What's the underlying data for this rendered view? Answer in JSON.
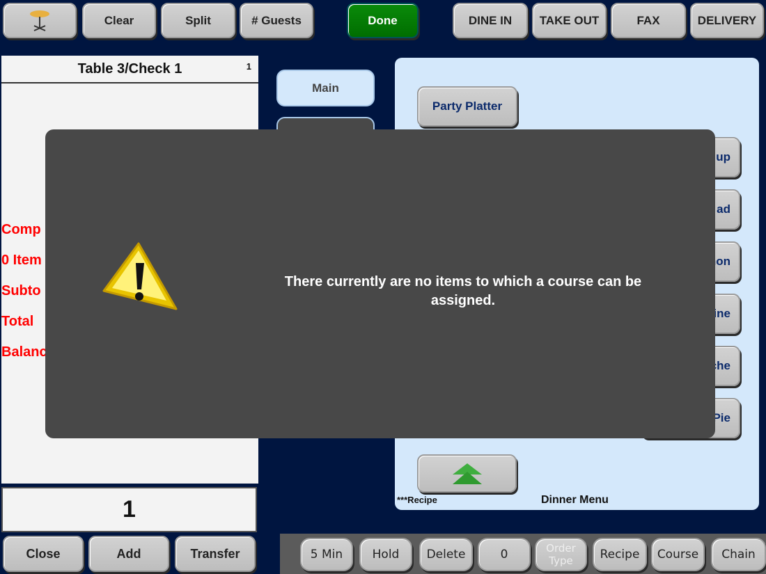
{
  "top_bar": {
    "table_icon": "table-icon",
    "clear": "Clear",
    "split": "Split",
    "guests": "# Guests",
    "done": "Done",
    "dine_in": "DINE IN",
    "take_out": "TAKE OUT",
    "fax": "FAX",
    "delivery": "DELIVERY"
  },
  "check": {
    "title": "Table 3/Check 1",
    "seat": "1",
    "labels": [
      "Comp",
      "0 Item",
      "Subto",
      "Total",
      "Balanc"
    ],
    "quantity": "1"
  },
  "bottom_left": {
    "close": "Close",
    "add": "Add",
    "transfer": "Transfer"
  },
  "tabs": {
    "main": "Main"
  },
  "menu": {
    "party_platter": "Party Platter",
    "items": [
      "up",
      "ad",
      "mon",
      "aine",
      "iche",
      "Pie"
    ],
    "recipe_note": "***Recipe",
    "menu_name": "Dinner Menu",
    "scroll_up_icon": "double-chevron-up-icon"
  },
  "bottom_bar": {
    "five_min": "5 Min",
    "hold": "Hold",
    "delete": "Delete",
    "zero": "0",
    "order_type": "Order Type",
    "recipe": "Recipe",
    "course": "Course",
    "chain": "Chain"
  },
  "dialog": {
    "icon": "warning-icon",
    "message": "There currently are no items to which a course can be assigned."
  },
  "colors": {
    "background": "#001540",
    "done": "#008000",
    "alert_text": "#ff0000",
    "dialog": "#484848"
  }
}
